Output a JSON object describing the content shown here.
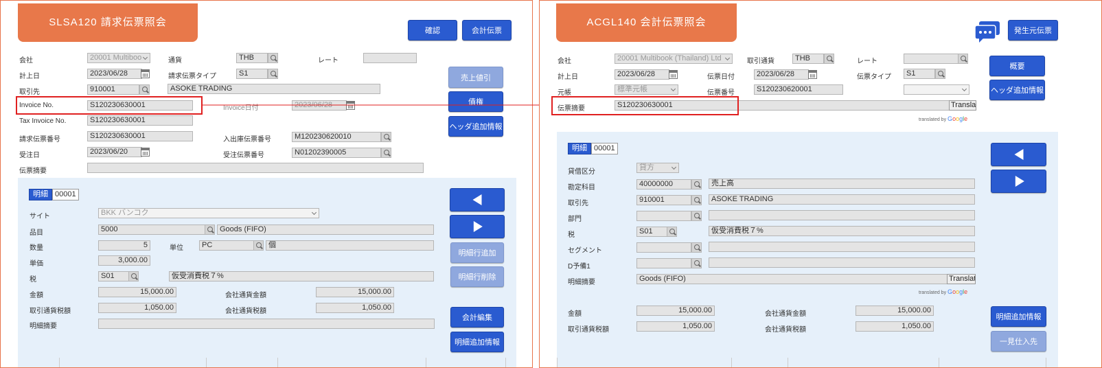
{
  "left": {
    "title": "SLSA120 請求伝票照会",
    "buttons": {
      "confirm": "確認",
      "accounting_voucher": "会計伝票"
    },
    "header": {
      "company_label": "会社",
      "company_value": "20001 Multiboo",
      "currency_label": "通貨",
      "currency_value": "THB",
      "rate_label": "レート",
      "rate_value": "",
      "posting_date_label": "計上日",
      "posting_date_value": "2023/06/28",
      "invoice_type_label": "請求伝票タイプ",
      "invoice_type_value": "S1",
      "customer_label": "取引先",
      "customer_code": "910001",
      "customer_name": "ASOKE TRADING",
      "invoice_no_label": "Invoice No.",
      "invoice_no_value": "S120230630001",
      "invoice_date_label": "Invoice日付",
      "invoice_date_value": "2023/06/28",
      "tax_invoice_label": "Tax Invoice No.",
      "tax_invoice_value": "S120230630001",
      "invoice_voucher_label": "請求伝票番号",
      "invoice_voucher_value": "S120230630001",
      "io_voucher_label": "入出庫伝票番号",
      "io_voucher_value": "M120230620010",
      "order_date_label": "受注日",
      "order_date_value": "2023/06/20",
      "order_no_label": "受注伝票番号",
      "order_no_value": "N01202390005",
      "memo_label": "伝票摘要",
      "memo_value": ""
    },
    "side_buttons": {
      "sales_discount": "売上値引",
      "receivable": "債権",
      "header_extra": "ヘッダ追加情報"
    },
    "detail": {
      "tag": "明細",
      "line_no": "00001",
      "site_label": "サイト",
      "site_value": "BKK バンコク",
      "item_label": "品目",
      "item_code": "5000",
      "item_name": "Goods (FIFO)",
      "qty_label": "数量",
      "qty_value": "5",
      "unit_label": "単位",
      "unit_code": "PC",
      "unit_name": "個",
      "price_label": "単価",
      "price_value": "3,000.00",
      "tax_label": "税",
      "tax_code": "S01",
      "tax_name": "仮受消費税７%",
      "amount_label": "金額",
      "amount_value": "15,000.00",
      "co_amount_label": "会社通貨金額",
      "co_amount_value": "15,000.00",
      "tx_tax_label": "取引通貨税額",
      "tx_tax_value": "1,050.00",
      "co_tax_label": "会社通貨税額",
      "co_tax_value": "1,050.00",
      "line_memo_label": "明細摘要",
      "line_memo_value": ""
    },
    "detail_buttons": {
      "add_line": "明細行追加",
      "delete_line": "明細行削除",
      "acct_edit": "会計編集",
      "line_extra": "明細追加情報"
    }
  },
  "right": {
    "title": "ACGL140 会計伝票照会",
    "buttons": {
      "source_voucher": "発生元伝票"
    },
    "header": {
      "company_label": "会社",
      "company_value": "20001 Multibook (Thailand) Ltd",
      "tx_currency_label": "取引通貨",
      "tx_currency_value": "THB",
      "rate_label": "レート",
      "rate_value": "",
      "posting_date_label": "計上日",
      "posting_date_value": "2023/06/28",
      "voucher_date_label": "伝票日付",
      "voucher_date_value": "2023/06/28",
      "voucher_type_label": "伝票タイプ",
      "voucher_type_value": "S1",
      "ledger_label": "元帳",
      "ledger_value": "標準元帳",
      "voucher_no_label": "伝票番号",
      "voucher_no_value": "S120230620001",
      "memo_label": "伝票摘要",
      "memo_value": "S120230630001",
      "translate_label": "Translat",
      "translated_by": "translated by"
    },
    "side_buttons": {
      "summary": "概要",
      "header_extra": "ヘッダ追加情報"
    },
    "detail": {
      "tag": "明細",
      "line_no": "00001",
      "dc_label": "貸借区分",
      "dc_value": "貸方",
      "account_label": "勘定科目",
      "account_code": "40000000",
      "account_name": "売上高",
      "partner_label": "取引先",
      "partner_code": "910001",
      "partner_name": "ASOKE TRADING",
      "dept_label": "部門",
      "tax_label": "税",
      "tax_code": "S01",
      "tax_name": "仮受消費税７%",
      "segment_label": "セグメント",
      "spare_label": "D予備1",
      "line_memo_label": "明細摘要",
      "line_memo_value": "Goods (FIFO)",
      "amount_label": "金額",
      "amount_value": "15,000.00",
      "co_amount_label": "会社通貨金額",
      "co_amount_value": "15,000.00",
      "tx_tax_label": "取引通貨税額",
      "tx_tax_value": "1,050.00",
      "co_tax_label": "会社通貨税額",
      "co_tax_value": "1,050.00"
    },
    "detail_buttons": {
      "line_extra": "明細追加情報",
      "bulk_purchase": "一見仕入先"
    }
  },
  "colors": {
    "brand_orange": "#e8784a",
    "button_blue": "#2a5bd0",
    "highlight_red": "#e02020"
  }
}
